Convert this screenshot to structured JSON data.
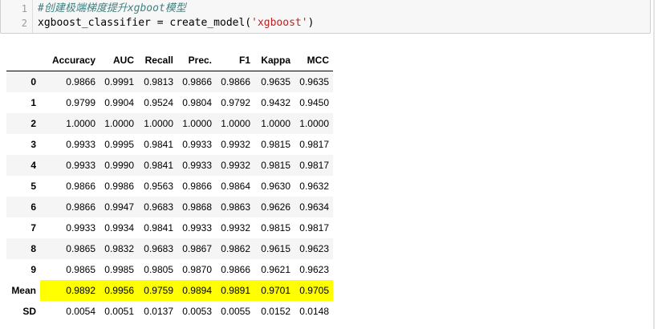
{
  "code_cell": {
    "line_numbers": [
      "1",
      "2"
    ],
    "comment_line": "#创建极端梯度提升xgboot模型",
    "code_var": "xgboost_classifier ",
    "code_eq": "= ",
    "code_call": "create_model(",
    "code_string": "'xgboost'",
    "code_close": ")"
  },
  "table": {
    "columns": [
      "",
      "Accuracy",
      "AUC",
      "Recall",
      "Prec.",
      "F1",
      "Kappa",
      "MCC"
    ],
    "rows": [
      {
        "index": "0",
        "values": [
          "0.9866",
          "0.9991",
          "0.9813",
          "0.9866",
          "0.9866",
          "0.9635",
          "0.9635"
        ]
      },
      {
        "index": "1",
        "values": [
          "0.9799",
          "0.9904",
          "0.9524",
          "0.9804",
          "0.9792",
          "0.9432",
          "0.9450"
        ]
      },
      {
        "index": "2",
        "values": [
          "1.0000",
          "1.0000",
          "1.0000",
          "1.0000",
          "1.0000",
          "1.0000",
          "1.0000"
        ]
      },
      {
        "index": "3",
        "values": [
          "0.9933",
          "0.9995",
          "0.9841",
          "0.9933",
          "0.9932",
          "0.9815",
          "0.9817"
        ]
      },
      {
        "index": "4",
        "values": [
          "0.9933",
          "0.9990",
          "0.9841",
          "0.9933",
          "0.9932",
          "0.9815",
          "0.9817"
        ]
      },
      {
        "index": "5",
        "values": [
          "0.9866",
          "0.9986",
          "0.9563",
          "0.9866",
          "0.9864",
          "0.9630",
          "0.9632"
        ]
      },
      {
        "index": "6",
        "values": [
          "0.9866",
          "0.9947",
          "0.9683",
          "0.9868",
          "0.9863",
          "0.9626",
          "0.9634"
        ]
      },
      {
        "index": "7",
        "values": [
          "0.9933",
          "0.9934",
          "0.9841",
          "0.9933",
          "0.9932",
          "0.9815",
          "0.9817"
        ]
      },
      {
        "index": "8",
        "values": [
          "0.9865",
          "0.9832",
          "0.9683",
          "0.9867",
          "0.9862",
          "0.9615",
          "0.9623"
        ]
      },
      {
        "index": "9",
        "values": [
          "0.9865",
          "0.9985",
          "0.9805",
          "0.9870",
          "0.9866",
          "0.9621",
          "0.9623"
        ]
      },
      {
        "index": "Mean",
        "values": [
          "0.9892",
          "0.9956",
          "0.9759",
          "0.9894",
          "0.9891",
          "0.9701",
          "0.9705"
        ],
        "highlighted": true
      },
      {
        "index": "SD",
        "values": [
          "0.0054",
          "0.0051",
          "0.0137",
          "0.0053",
          "0.0055",
          "0.0152",
          "0.0148"
        ]
      }
    ],
    "highlight_color": "#ffff00"
  }
}
